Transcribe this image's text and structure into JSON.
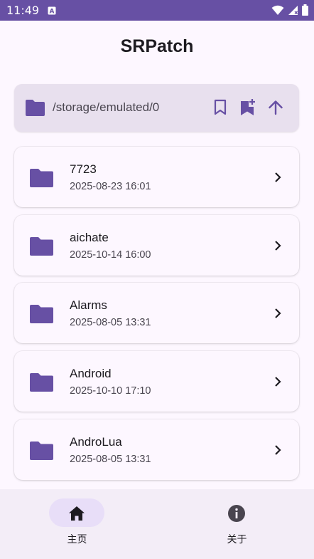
{
  "status_bar": {
    "time": "11:49"
  },
  "app": {
    "title": "SRPatch"
  },
  "path_bar": {
    "path": "/storage/emulated/0",
    "actions": [
      "bookmark-icon",
      "bookmark-add-icon",
      "arrow-up-icon"
    ]
  },
  "files": [
    {
      "name": "7723",
      "date": "2025-08-23 16:01"
    },
    {
      "name": "aichate",
      "date": "2025-10-14 16:00"
    },
    {
      "name": "Alarms",
      "date": "2025-08-05 13:31"
    },
    {
      "name": "Android",
      "date": "2025-10-10 17:10"
    },
    {
      "name": "AndroLua",
      "date": "2025-08-05 13:31"
    }
  ],
  "bottom_nav": {
    "items": [
      {
        "label": "主页",
        "icon": "home-icon",
        "selected": true
      },
      {
        "label": "关于",
        "icon": "info-icon",
        "selected": false
      }
    ]
  },
  "colors": {
    "accent": "#6750a4",
    "folder": "#6750a4",
    "path_bar_bg": "#e8e0ee",
    "nav_selected_bg": "#e8def8"
  }
}
